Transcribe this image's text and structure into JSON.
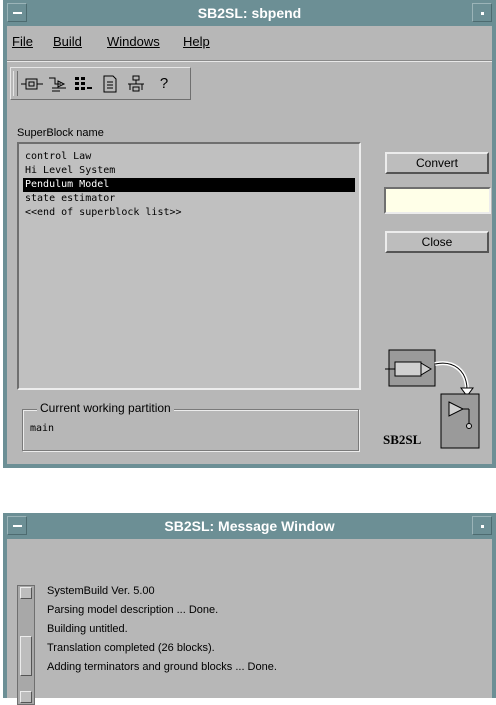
{
  "main_window": {
    "title": "SB2SL: sbpend",
    "menu": [
      {
        "label": "File"
      },
      {
        "label": "Build"
      },
      {
        "label": "Windows"
      },
      {
        "label": "Help"
      }
    ],
    "toolbar_icons": [
      "convert-icon",
      "build-icon",
      "catalog-icon",
      "document-icon",
      "hierarchy-icon",
      "help-icon"
    ],
    "toolbar_help_glyph": "?",
    "superblock_label": "SuperBlock name",
    "superblocks": [
      "control Law",
      "Hi Level System",
      "Pendulum Model",
      "state estimator",
      "<<end of superblock list>>"
    ],
    "selected_index": 2,
    "convert_label": "Convert",
    "name_input_value": "",
    "close_label": "Close",
    "partition_title": "Current working partition",
    "partition_value": "main",
    "logo_text": "SB2SL"
  },
  "message_window": {
    "title": "SB2SL: Message Window",
    "lines": [
      "SystemBuild Ver. 5.00",
      "Parsing model description ... Done.",
      "Building untitled.",
      "Translation completed (26 blocks).",
      "Adding terminators and ground blocks ... Done."
    ]
  },
  "colors": {
    "titlebar": "#6c8f95",
    "window_bg": "#b7b7b7",
    "selection": "#000000",
    "input_bg": "#ffffe8"
  }
}
